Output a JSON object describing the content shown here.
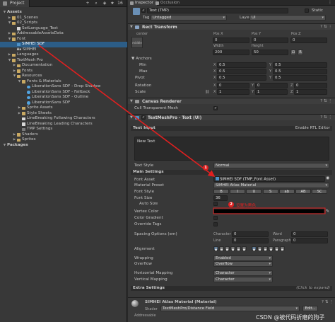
{
  "project": {
    "tab": "Project",
    "tree": [
      {
        "label": "Assets",
        "depth": 0,
        "kind": "arrow",
        "bold": true
      },
      {
        "label": "01_Scenes",
        "depth": 1,
        "kind": "folder"
      },
      {
        "label": "02_Scripts",
        "depth": 1,
        "kind": "folder",
        "open": true
      },
      {
        "label": "SetLanguage_Text",
        "depth": 2,
        "kind": "file"
      },
      {
        "label": "AddressableAssetsData",
        "depth": 1,
        "kind": "folder"
      },
      {
        "label": "Font",
        "depth": 1,
        "kind": "folder",
        "open": true
      },
      {
        "label": "SIMHEI SDF",
        "depth": 2,
        "kind": "font",
        "selected": true
      },
      {
        "label": "SIMHEI",
        "depth": 2,
        "kind": "aa"
      },
      {
        "label": "Languages",
        "depth": 1,
        "kind": "folder"
      },
      {
        "label": "TextMesh Pro",
        "depth": 1,
        "kind": "folder",
        "open": true
      },
      {
        "label": "Documentation",
        "depth": 2,
        "kind": "folder"
      },
      {
        "label": "Fonts",
        "depth": 2,
        "kind": "folder"
      },
      {
        "label": "Resources",
        "depth": 2,
        "kind": "folder",
        "open": true
      },
      {
        "label": "Fonts & Materials",
        "depth": 3,
        "kind": "folder",
        "open": true
      },
      {
        "label": "LiberationSans SDF - Drop Shadow",
        "depth": 4,
        "kind": "sdf"
      },
      {
        "label": "LiberationSans SDF - Fallback",
        "depth": 4,
        "kind": "sdf"
      },
      {
        "label": "LiberationSans SDF - Outline",
        "depth": 4,
        "kind": "sdf"
      },
      {
        "label": "LiberationSans SDF",
        "depth": 4,
        "kind": "sdf"
      },
      {
        "label": "Sprite Assets",
        "depth": 3,
        "kind": "folder"
      },
      {
        "label": "Style Sheets",
        "depth": 3,
        "kind": "folder"
      },
      {
        "label": "LineBreaking Following Characters",
        "depth": 3,
        "kind": "file"
      },
      {
        "label": "LineBreaking Leading Characters",
        "depth": 3,
        "kind": "file"
      },
      {
        "label": "TMP Settings",
        "depth": 3,
        "kind": "asset"
      },
      {
        "label": "Shaders",
        "depth": 2,
        "kind": "folder"
      },
      {
        "label": "Sprites",
        "depth": 2,
        "kind": "folder"
      },
      {
        "label": "Packages",
        "depth": 0,
        "kind": "arrow",
        "bold": true
      }
    ],
    "search_count": "16"
  },
  "inspector": {
    "tabs": [
      "Inspector",
      "Occlusion"
    ],
    "object": {
      "name": "Text (TMP)",
      "static_label": "Static",
      "tag_label": "Tag",
      "tag_value": "Untagged",
      "layer_label": "Layer",
      "layer_value": "UI"
    },
    "rect_transform": {
      "title": "Rect Transform",
      "anchor_preset": "center",
      "middle_label": "middle",
      "pos_x_label": "Pos X",
      "pos_y_label": "Pos Y",
      "pos_z_label": "Pos Z",
      "pos_x": "0",
      "pos_y": "0",
      "pos_z": "0",
      "width_label": "Width",
      "height_label": "Height",
      "width": "200",
      "height": "50",
      "anchors_label": "Anchors",
      "min_label": "Min",
      "max_label": "Max",
      "pivot_label": "Pivot",
      "min_x": "0.5",
      "min_y": "0.5",
      "max_x": "0.5",
      "max_y": "0.5",
      "pivot_x": "0.5",
      "pivot_y": "0.5",
      "rotation_label": "Rotation",
      "rot_x": "0",
      "rot_y": "0",
      "rot_z": "0",
      "scale_label": "Scale",
      "scale_x": "1",
      "scale_y": "1",
      "scale_z": "1",
      "x": "X",
      "y": "Y",
      "z": "Z"
    },
    "canvas_renderer": {
      "title": "Canvas Renderer",
      "cull_label": "Cull Transparent Mesh"
    },
    "tmp": {
      "title": "TextMeshPro - Text (UI)",
      "text_input_label": "Text Input",
      "enable_rtl": "Enable RTL Editor",
      "text_value": "New Text",
      "text_style_label": "Text Style",
      "text_style_value": "Normal",
      "main_settings": "Main Settings",
      "font_asset_label": "Font Asset",
      "font_asset_value": "SIMHEI SDF (TMP_Font Asset)",
      "material_preset_label": "Material Preset",
      "material_preset_value": "SIMHEI Atlas Material",
      "font_style_label": "Font Style",
      "font_style_buttons": [
        "B",
        "I",
        "U",
        "S",
        "ab",
        "AB",
        "SC"
      ],
      "font_size_label": "Font Size",
      "font_size_value": "36",
      "auto_size_label": "Auto Size",
      "vertex_color_label": "Vertex Color",
      "color_gradient_label": "Color Gradient",
      "override_tags_label": "Override Tags",
      "spacing_label": "Spacing Options (em)",
      "character_label": "Character",
      "character_value": "0",
      "word_label": "Word",
      "word_value": "0",
      "line_label": "Line",
      "line_value": "0",
      "paragraph_label": "Paragraph",
      "paragraph_value": "0",
      "alignment_label": "Alignment",
      "wrapping_label": "Wrapping",
      "wrapping_value": "Enabled",
      "overflow_label": "Overflow",
      "overflow_value": "Overflow",
      "hmap_label": "Horizontal Mapping",
      "hmap_value": "Character",
      "vmap_label": "Vertical Mapping",
      "vmap_value": "Character",
      "extra_settings": "Extra Settings",
      "click_to_expand": "(Click to expand)"
    },
    "material": {
      "title": "SIMHEI Atlas Material (Material)",
      "shader_label": "Shader",
      "shader_value": "TextMeshPro/Distance Field",
      "edit_label": "Edit...",
      "addressable_label": "Addressable"
    }
  },
  "annotations": {
    "badge1": "1",
    "badge2": "2",
    "badge2_text": "设置为黑色"
  },
  "watermark": "CSDN @被代码折磨的狗子",
  "colors": {
    "selection": "#2c5d87",
    "arrow": "#e02020",
    "panel": "#383838"
  }
}
